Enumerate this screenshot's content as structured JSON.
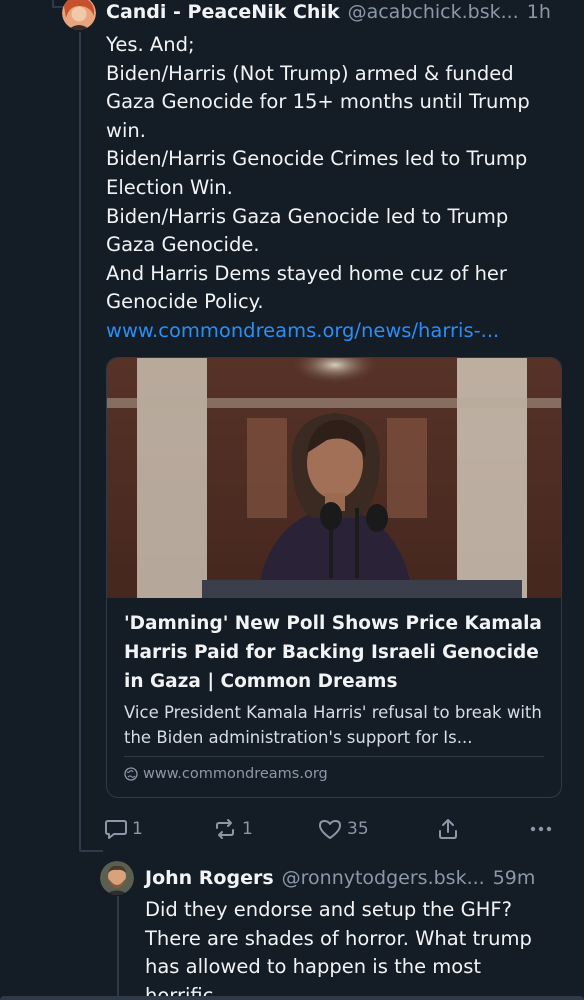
{
  "post1": {
    "display_name": "Candi - PeaceNik Chik",
    "handle": "@acabchick.bsk...",
    "time": "1h",
    "text": "Yes. And;\nBiden/Harris (Not Trump) armed & funded\nGaza Genocide for 15+ months until Trump\nwin.\nBiden/Harris Genocide Crimes led to Trump\nElection Win.\nBiden/Harris Gaza Genocide led to Trump\nGaza Genocide.\nAnd Harris Dems stayed home cuz of her\nGenocide Policy.",
    "link": "www.commondreams.org/news/harris-...",
    "card": {
      "title": "'Damning' New Poll Shows Price Kamala Harris Paid for Backing Israeli Genocide in Gaza | Common Dreams",
      "description": "Vice President Kamala Harris' refusal to break with the Biden administration's support for Is...",
      "domain": "www.commondreams.org"
    },
    "actions": {
      "replies": "1",
      "reposts": "1",
      "likes": "35"
    }
  },
  "post2": {
    "display_name": "John Rogers",
    "handle": "@ronnytodgers.bsk...",
    "time": "59m",
    "text": "Did they endorse and setup the GHF?\nThere are shades of horror. What trump\nhas allowed to happen is the most\nhorrific"
  },
  "colors": {
    "background": "#141c26",
    "link": "#2c8ef3",
    "muted": "#8b98a7",
    "border": "#2e3a48"
  }
}
